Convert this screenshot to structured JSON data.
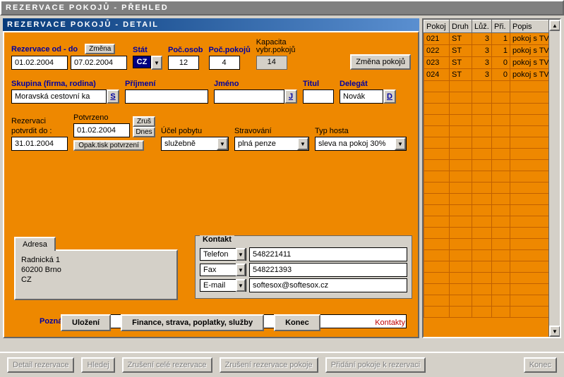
{
  "window": {
    "outer_title": "REZERVACE POKOJŮ - PŘEHLED",
    "inner_title": "REZERVACE POKOJŮ - DETAIL"
  },
  "dates": {
    "label": "Rezervace od - do",
    "change_btn": "Změna",
    "from": "01.02.2004",
    "to": "07.02.2004"
  },
  "stat": {
    "label": "Stát",
    "value": "CZ"
  },
  "persons": {
    "label": "Poč.osob",
    "value": "12"
  },
  "rooms": {
    "label": "Poč.pokojů",
    "value": "4"
  },
  "capacity": {
    "label1": "Kapacita",
    "label2": "vybr.pokojů",
    "value": "14"
  },
  "change_rooms_btn": "Změna pokojů",
  "group": {
    "label": "Skupina (firma, rodina)",
    "value": "Moravská cestovní ka",
    "s_btn": "S"
  },
  "surname": {
    "label": "Příjmení",
    "value": ""
  },
  "name": {
    "label": "Jméno",
    "value": "",
    "j_btn": "J"
  },
  "title": {
    "label": "Titul",
    "value": ""
  },
  "delegate": {
    "label": "Delegát",
    "value": "Novák",
    "d_btn": "D"
  },
  "confirm": {
    "label1": "Rezervaci",
    "label2": "potvrdit do :",
    "confirm_date": "31.01.2004",
    "confirmed_label": "Potvrzeno",
    "confirmed_date": "01.02.2004",
    "cancel_btn": "Zruš",
    "today_btn": "Dnes",
    "reprint_btn": "Opak.tisk potvrzení"
  },
  "purpose": {
    "label": "Účel pobytu",
    "value": "služebně"
  },
  "board": {
    "label": "Stravování",
    "value": "plná penze"
  },
  "guest_type": {
    "label": "Typ hosta",
    "value": "sleva na pokoj 30%"
  },
  "address": {
    "tab": "Adresa",
    "line1": "Radnická 1",
    "line2": "60200  Brno",
    "line3": "CZ"
  },
  "contact": {
    "legend": "Kontakt",
    "phone_label": "Telefon",
    "phone": "548221411",
    "fax_label": "Fax",
    "fax": "548221393",
    "email_label": "E-mail",
    "email": "softesox@softesox.cz"
  },
  "note": {
    "label": "Poznámka :",
    "value": ""
  },
  "actions": {
    "save": "Uložení",
    "finance": "Finance, strava, poplatky, služby",
    "end": "Konec",
    "contacts": "Kontakty"
  },
  "table": {
    "headers": [
      "Pokoj",
      "Druh",
      "Lůž.",
      "Při.",
      "Popis"
    ],
    "rows": [
      [
        "021",
        "ST",
        "3",
        "1",
        "pokoj s TV, s"
      ],
      [
        "022",
        "ST",
        "3",
        "1",
        "pokoj s TV, s"
      ],
      [
        "023",
        "ST",
        "3",
        "0",
        "pokoj s TV, l"
      ],
      [
        "024",
        "ST",
        "3",
        "0",
        "pokoj s TV, l"
      ]
    ]
  },
  "footer": {
    "detail": "Detail rezervace",
    "search": "Hledej",
    "cancel_all": "Zrušení celé rezervace",
    "cancel_room": "Zrušení rezervace pokoje",
    "add_room": "Přidání pokoje k rezervaci",
    "end": "Konec"
  }
}
